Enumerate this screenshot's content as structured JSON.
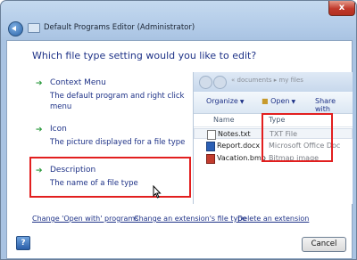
{
  "window": {
    "title": "Default Programs Editor (Administrator)",
    "close_glyph": "x"
  },
  "question": "Which file type setting would you like to edit?",
  "options": [
    {
      "title": "Context Menu",
      "description": "The default program and right click menu"
    },
    {
      "title": "Icon",
      "description": "The picture displayed for a file type"
    },
    {
      "title": "Description",
      "description": "The name of a file type"
    }
  ],
  "explorer": {
    "breadcrumb": "« documents ▸ my files",
    "toolbar": {
      "organize": "Organize",
      "open": "Open",
      "share": "Share with"
    },
    "columns": {
      "name": "Name",
      "type": "Type"
    },
    "files": [
      {
        "name": "Notes.txt",
        "type": "TXT File",
        "icon": "text-file-icon"
      },
      {
        "name": "Report.docx",
        "type": "Microsoft Office Doc",
        "icon": "word-document-icon"
      },
      {
        "name": "Vacation.bmp",
        "type": "Bitmap image",
        "icon": "bitmap-image-icon"
      }
    ]
  },
  "links": {
    "open_with": "Change 'Open with' programs",
    "extension": "Change an extension's file type",
    "delete": "Delete an extension"
  },
  "buttons": {
    "help": "?",
    "cancel": "Cancel"
  },
  "colors": {
    "highlight": "#e21f1f",
    "link": "#1e3287",
    "arrow": "#2a9a3c"
  }
}
